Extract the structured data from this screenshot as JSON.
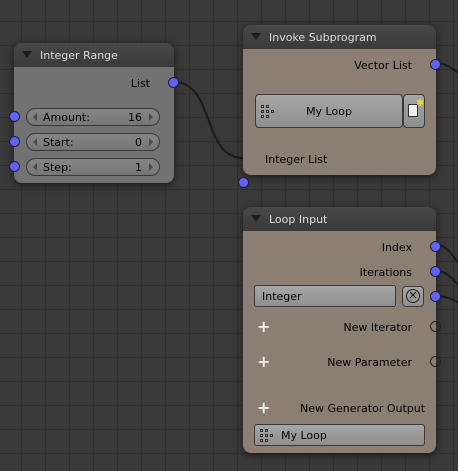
{
  "integer_range": {
    "title": "Integer Range",
    "output_label": "List",
    "fields": [
      {
        "label": "Amount:",
        "value": "16"
      },
      {
        "label": "Start:",
        "value": "0"
      },
      {
        "label": "Step:",
        "value": "1"
      }
    ]
  },
  "invoke_subprogram": {
    "title": "Invoke Subprogram",
    "output_label": "Vector List",
    "program_button": "My Loop",
    "input_label": "Integer List"
  },
  "loop_input": {
    "title": "Loop Input",
    "outputs": {
      "index": "Index",
      "iterations": "Iterations"
    },
    "type_field": "Integer",
    "new_iterator": "New Iterator",
    "new_parameter": "New Parameter",
    "new_generator_output": "New Generator Output",
    "loop_name": "My Loop"
  },
  "colors": {
    "canvas": "#393939",
    "grid": "#2f2f2f",
    "node_header": "#484848",
    "gray_node_body": "#727272",
    "brown_node_body": "#8a7f72",
    "socket": "#6363f2",
    "link": "#1a1a1a"
  },
  "icons": {
    "collapse": "triangle-down-icon",
    "add": "plus-icon",
    "program": "node-tree-icon",
    "new_file": "new-document-icon",
    "remove": "x-icon"
  }
}
